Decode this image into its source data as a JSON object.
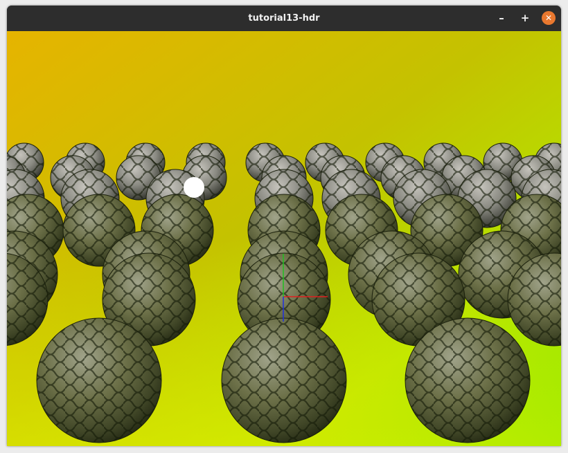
{
  "window": {
    "title": "tutorial13-hdr",
    "controls": {
      "minimize": "–",
      "maximize": "+",
      "close": "✕"
    }
  },
  "scene": {
    "background_gradient": [
      "#e6b400",
      "#c4c200",
      "#e2f000",
      "#6ee800"
    ],
    "sphere_rows": 7,
    "sphere_columns": 7,
    "light_color": "#ffffff",
    "gizmo_axes": {
      "x": "#e02020",
      "y": "#20c020",
      "z": "#2030e0"
    }
  }
}
